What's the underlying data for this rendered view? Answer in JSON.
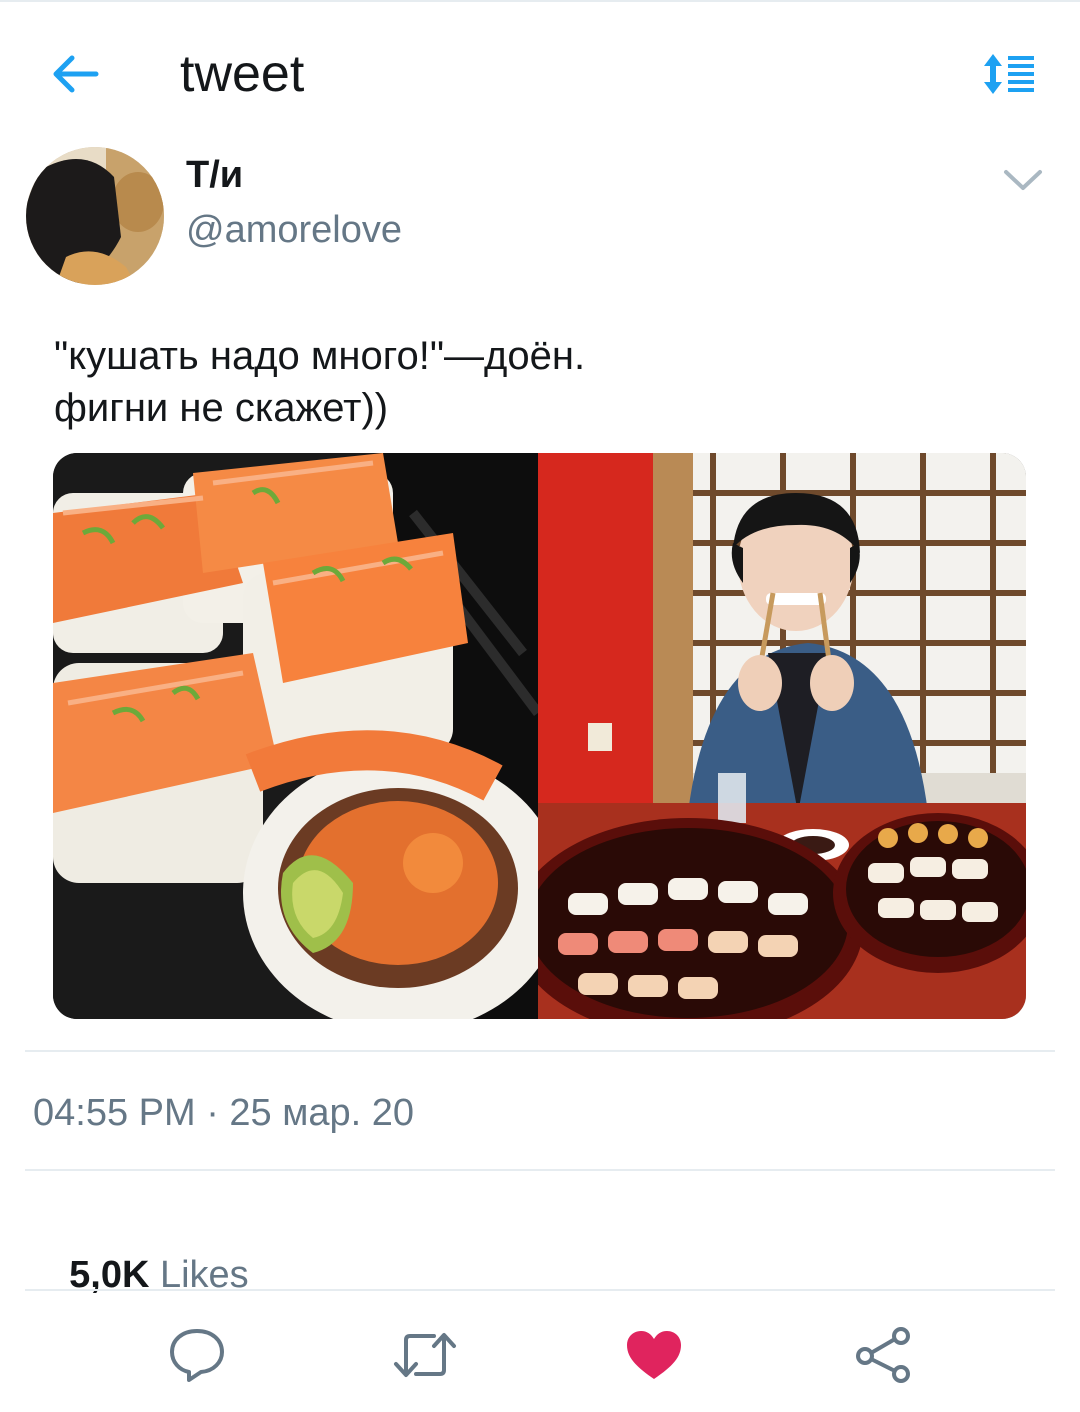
{
  "header": {
    "title": "tweet",
    "back_icon": "arrow-left-icon",
    "sort_icon": "sort-list-icon",
    "accent_color": "#1da1f2"
  },
  "author": {
    "display_name": "Т/и",
    "handle": "@amorelove",
    "menu_icon": "chevron-down-icon"
  },
  "tweet": {
    "text_lines": [
      "\"кушать надо много!\"—доён.",
      "фигни не скажет))"
    ]
  },
  "media": {
    "count": 2
  },
  "meta": {
    "timestamp": "04:55 PM · 25 мар. 20"
  },
  "stats": {
    "likes_count": "5,0K",
    "likes_label": " Likes"
  },
  "actions": {
    "reply_icon": "reply-icon",
    "retweet_icon": "retweet-icon",
    "like_icon": "heart-icon",
    "share_icon": "share-icon",
    "like_color": "#e0245e",
    "icon_color": "#657786"
  }
}
